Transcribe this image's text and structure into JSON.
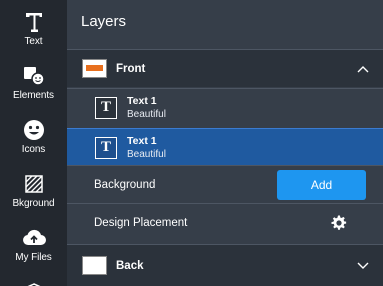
{
  "rail": {
    "items": [
      {
        "label": "Text",
        "icon": "text-icon"
      },
      {
        "label": "Elements",
        "icon": "elements-icon"
      },
      {
        "label": "Icons",
        "icon": "smiley-icon"
      },
      {
        "label": "Bkground",
        "icon": "background-pattern-icon"
      },
      {
        "label": "My Files",
        "icon": "cloud-upload-icon"
      }
    ]
  },
  "panel": {
    "title": "Layers",
    "sections": [
      {
        "name": "Front",
        "expanded": true,
        "thumb_color": "#e8701e",
        "layers": [
          {
            "title": "Text 1",
            "subtitle": "Beautiful",
            "selected": false
          },
          {
            "title": "Text 1",
            "subtitle": "Beautiful",
            "selected": true
          }
        ],
        "background_label": "Background",
        "add_label": "Add",
        "placement_label": "Design Placement"
      },
      {
        "name": "Back",
        "expanded": false
      }
    ]
  },
  "colors": {
    "rail_bg": "#23282f",
    "panel_bg": "#363e49",
    "selected_bg": "#1f5aa0",
    "accent": "#1e96f0"
  }
}
